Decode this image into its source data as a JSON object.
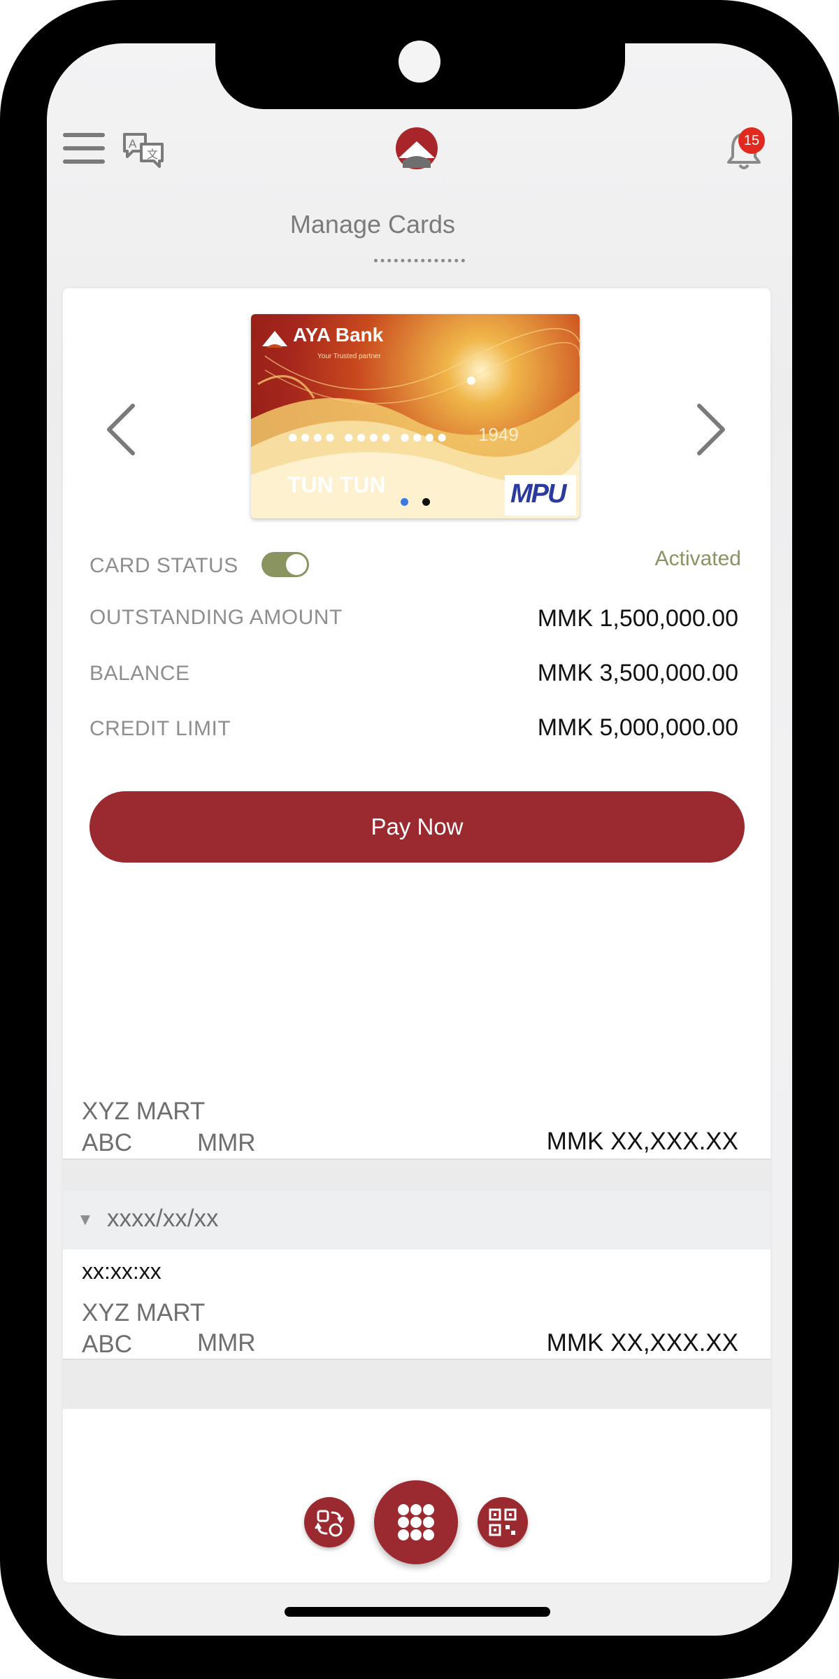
{
  "header": {
    "title": "Manage Cards",
    "notification_count": "15",
    "icons": {
      "menu": "hamburger-icon",
      "language": "translate-icon",
      "logo": "aya-logo",
      "notifications": "bell-icon"
    }
  },
  "card": {
    "bank_name": "AYA Bank",
    "tagline": "Your Trusted partner",
    "masked_number": "●●●● ●●●● ●●●●",
    "last_digits": "1949",
    "holder": "TUN TUN",
    "brand": "MPU",
    "carousel_active_index": 0,
    "carousel_count": 2
  },
  "details": {
    "status_label": "CARD STATUS",
    "status_value": "Activated",
    "status_on": true,
    "rows": [
      {
        "label": "OUTSTANDING AMOUNT",
        "value": "MMK 1,500,000.00"
      },
      {
        "label": "BALANCE",
        "value": "MMK 3,500,000.00"
      },
      {
        "label": "CREDIT LIMIT",
        "value": "MMK 5,000,000.00"
      }
    ]
  },
  "pay_button": "Pay Now",
  "transactions": [
    {
      "merchant": "XYZ MART",
      "city": "ABC",
      "country": "MMR",
      "amount": "MMK XX,XXX.XX"
    },
    {
      "date": "xxxx/xx/xx",
      "time": "xx:xx:xx",
      "merchant": "XYZ MART",
      "city": "ABC",
      "country": "MMR",
      "amount": "MMK XX,XXX.XX"
    }
  ],
  "bottom_nav": {
    "left": "transfer-icon",
    "center": "apps-grid-icon",
    "right": "qr-code-icon"
  },
  "colors": {
    "brand": "#9b2a30",
    "status": "#8a9461",
    "badge": "#e02a1f",
    "carousel_active": "#3a7be0"
  }
}
